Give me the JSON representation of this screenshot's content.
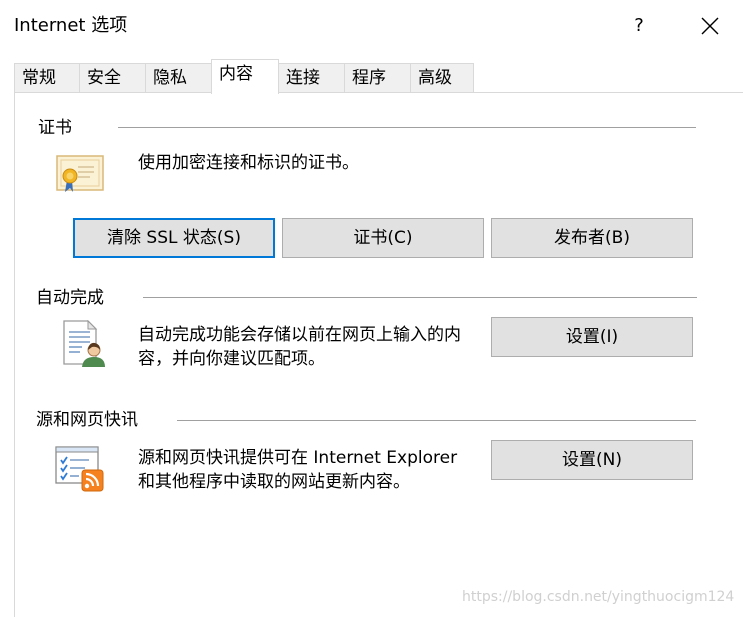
{
  "window": {
    "title": "Internet 选项",
    "help_label": "?"
  },
  "tabs": [
    {
      "label": "常规"
    },
    {
      "label": "安全"
    },
    {
      "label": "隐私"
    },
    {
      "label": "内容"
    },
    {
      "label": "连接"
    },
    {
      "label": "程序"
    },
    {
      "label": "高级"
    }
  ],
  "active_tab": "内容",
  "certificates": {
    "group_label": "证书",
    "description": "使用加密连接和标识的证书。",
    "clear_ssl_label": "清除 SSL 状态(S)",
    "certificates_label": "证书(C)",
    "publishers_label": "发布者(B)",
    "icon": "certificate-icon"
  },
  "autocomplete": {
    "group_label": "自动完成",
    "description_line1": "自动完成功能会存储以前在网页上输入的内",
    "description_line2": "容，并向你建议匹配项。",
    "settings_label": "设置(I)",
    "icon": "autocomplete-icon"
  },
  "feeds": {
    "group_label": "源和网页快讯",
    "description_line1": "源和网页快讯提供可在 Internet Explorer",
    "description_line2": "和其他程序中读取的网站更新内容。",
    "settings_label": "设置(N)",
    "icon": "rss-feed-icon"
  },
  "watermark": "https://blog.csdn.net/yingthuocigm124",
  "colors": {
    "focus_border": "#0078d7",
    "button_bg": "#e1e1e1",
    "rss_orange": "#f5821f"
  }
}
